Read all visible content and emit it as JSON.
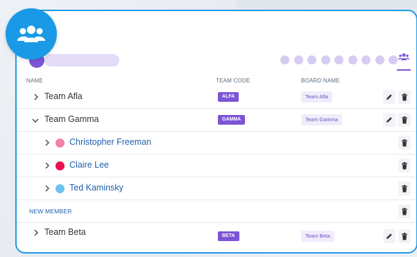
{
  "toolbar": {
    "indicators": 9,
    "team_tab_icon": "team-icon",
    "badge_icon": "users-group-icon"
  },
  "colors": {
    "accent": "#1a9ae6",
    "purple": "#7b55d6",
    "link": "#1e5fb0"
  },
  "table": {
    "headers": {
      "name": "NAME",
      "team_code": "TEAM CODE",
      "board_name": "BOARD NAME"
    },
    "teams": [
      {
        "name": "Team Afla",
        "code": "ALFA",
        "board": "Team Afla",
        "expanded": false
      },
      {
        "name": "Team Gamma",
        "code": "GAMMA",
        "board": "Team Gamma",
        "expanded": true,
        "members": [
          {
            "name": "Christopher Freeman",
            "color": "#f282a6"
          },
          {
            "name": "Claire Lee",
            "color": "#e8104e"
          },
          {
            "name": "Ted Kaminsky",
            "color": "#6cc3f0"
          }
        ],
        "new_member_label": "NEW MEMBER"
      },
      {
        "name": "Team Beta",
        "code": "BETA",
        "board": "Team Beta",
        "expanded": false
      }
    ]
  }
}
